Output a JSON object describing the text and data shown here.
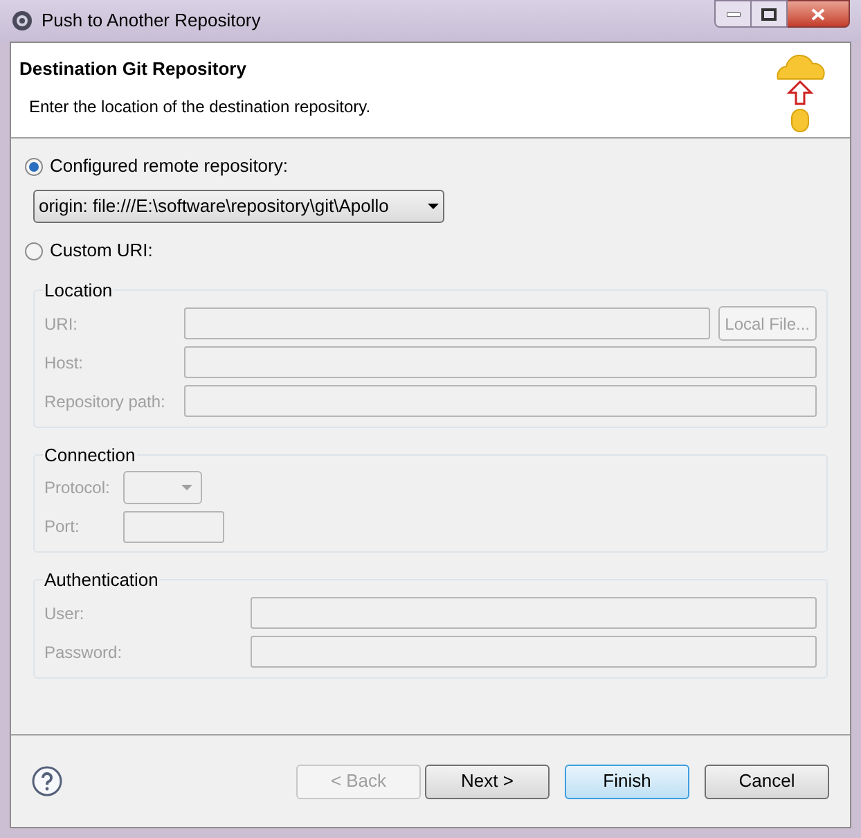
{
  "window": {
    "title": "Push to Another Repository"
  },
  "header": {
    "title": "Destination Git Repository",
    "description": "Enter the location of the destination repository."
  },
  "options": [
    {
      "kind": "combo",
      "label": "Configured remote repository:",
      "selected": true,
      "value": "origin: file:///E:\\software\\repository\\git\\Apollo"
    },
    {
      "kind": "plain",
      "label": "Custom URI:",
      "selected": false
    }
  ],
  "groups": [
    {
      "title": "Location",
      "disabled": true,
      "fields": [
        {
          "kind": "text",
          "label": "URI:",
          "button": "Local File..."
        },
        {
          "kind": "text",
          "label": "Host:"
        },
        {
          "kind": "text",
          "label": "Repository path:"
        }
      ]
    },
    {
      "title": "Connection",
      "disabled": true,
      "fields": [
        {
          "kind": "combo",
          "label": "Protocol:"
        },
        {
          "kind": "short",
          "label": "Port:"
        }
      ]
    },
    {
      "title": "Authentication",
      "disabled": true,
      "fields": [
        {
          "kind": "text",
          "label": "User:"
        },
        {
          "kind": "text",
          "label": "Password:"
        }
      ]
    }
  ],
  "buttons": [
    {
      "label": "< Back",
      "disabled": true,
      "default": false
    },
    {
      "label": "Next >",
      "disabled": false,
      "default": false
    },
    {
      "label": "Finish",
      "disabled": false,
      "default": true
    },
    {
      "label": "Cancel",
      "disabled": false,
      "default": false
    }
  ]
}
